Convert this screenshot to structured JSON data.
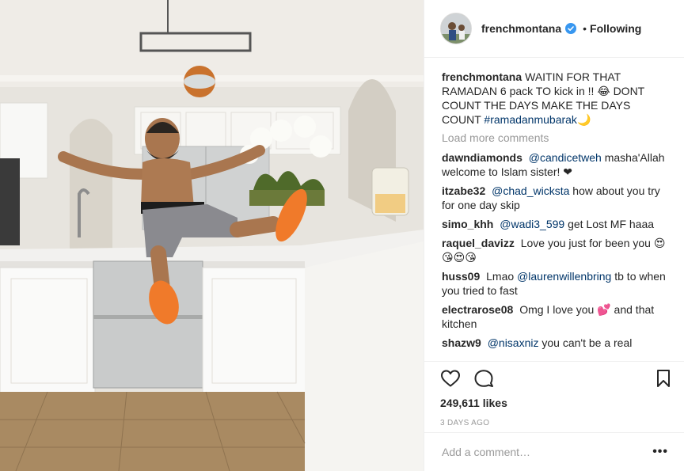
{
  "post": {
    "author": {
      "username": "frenchmontana",
      "follow_status": "Following",
      "verified_icon": "verified-badge-icon",
      "accent": "#3897f0"
    },
    "caption": {
      "username": "frenchmontana",
      "text": "WAITIN FOR THAT RAMADAN 6 pack TO kick in !! 😂 DONT COUNT THE DAYS MAKE THE DAYS COUNT",
      "hashtag": "#ramadanmubarak",
      "trailing_emoji": "🌙"
    },
    "load_more_label": "Load more comments",
    "comments": [
      {
        "username": "dawndiamonds",
        "mention": "@candicetweh",
        "text": "masha'Allah welcome to Islam sister! ❤"
      },
      {
        "username": "itzabe32",
        "mention": "@chad_wicksta",
        "text": "how about you try for one day skip"
      },
      {
        "username": "simo_khh",
        "mention": "@wadi3_599",
        "text": "get Lost MF haaa"
      },
      {
        "username": "raquel_davizz",
        "mention": "",
        "text": "Love you just for been you 😍😘😍😘"
      },
      {
        "username": "huss09",
        "mention": "",
        "text": "Lmao",
        "mention_after": "@laurenwillenbring",
        "text_after": "tb to when you tried to fast"
      },
      {
        "username": "electrarose08",
        "mention": "",
        "text": "Omg I love you 💕 and that kitchen"
      },
      {
        "username": "shazw9",
        "mention": "@nisaxniz",
        "text": "you can't be a real"
      }
    ],
    "likes": "249,611 likes",
    "timestamp": "3 DAYS AGO",
    "add_comment_placeholder": "Add a comment…",
    "more_options_label": "•••"
  },
  "colors": {
    "link": "#003569",
    "muted": "#999999",
    "text": "#262626",
    "slipper": "#f07a2a"
  }
}
